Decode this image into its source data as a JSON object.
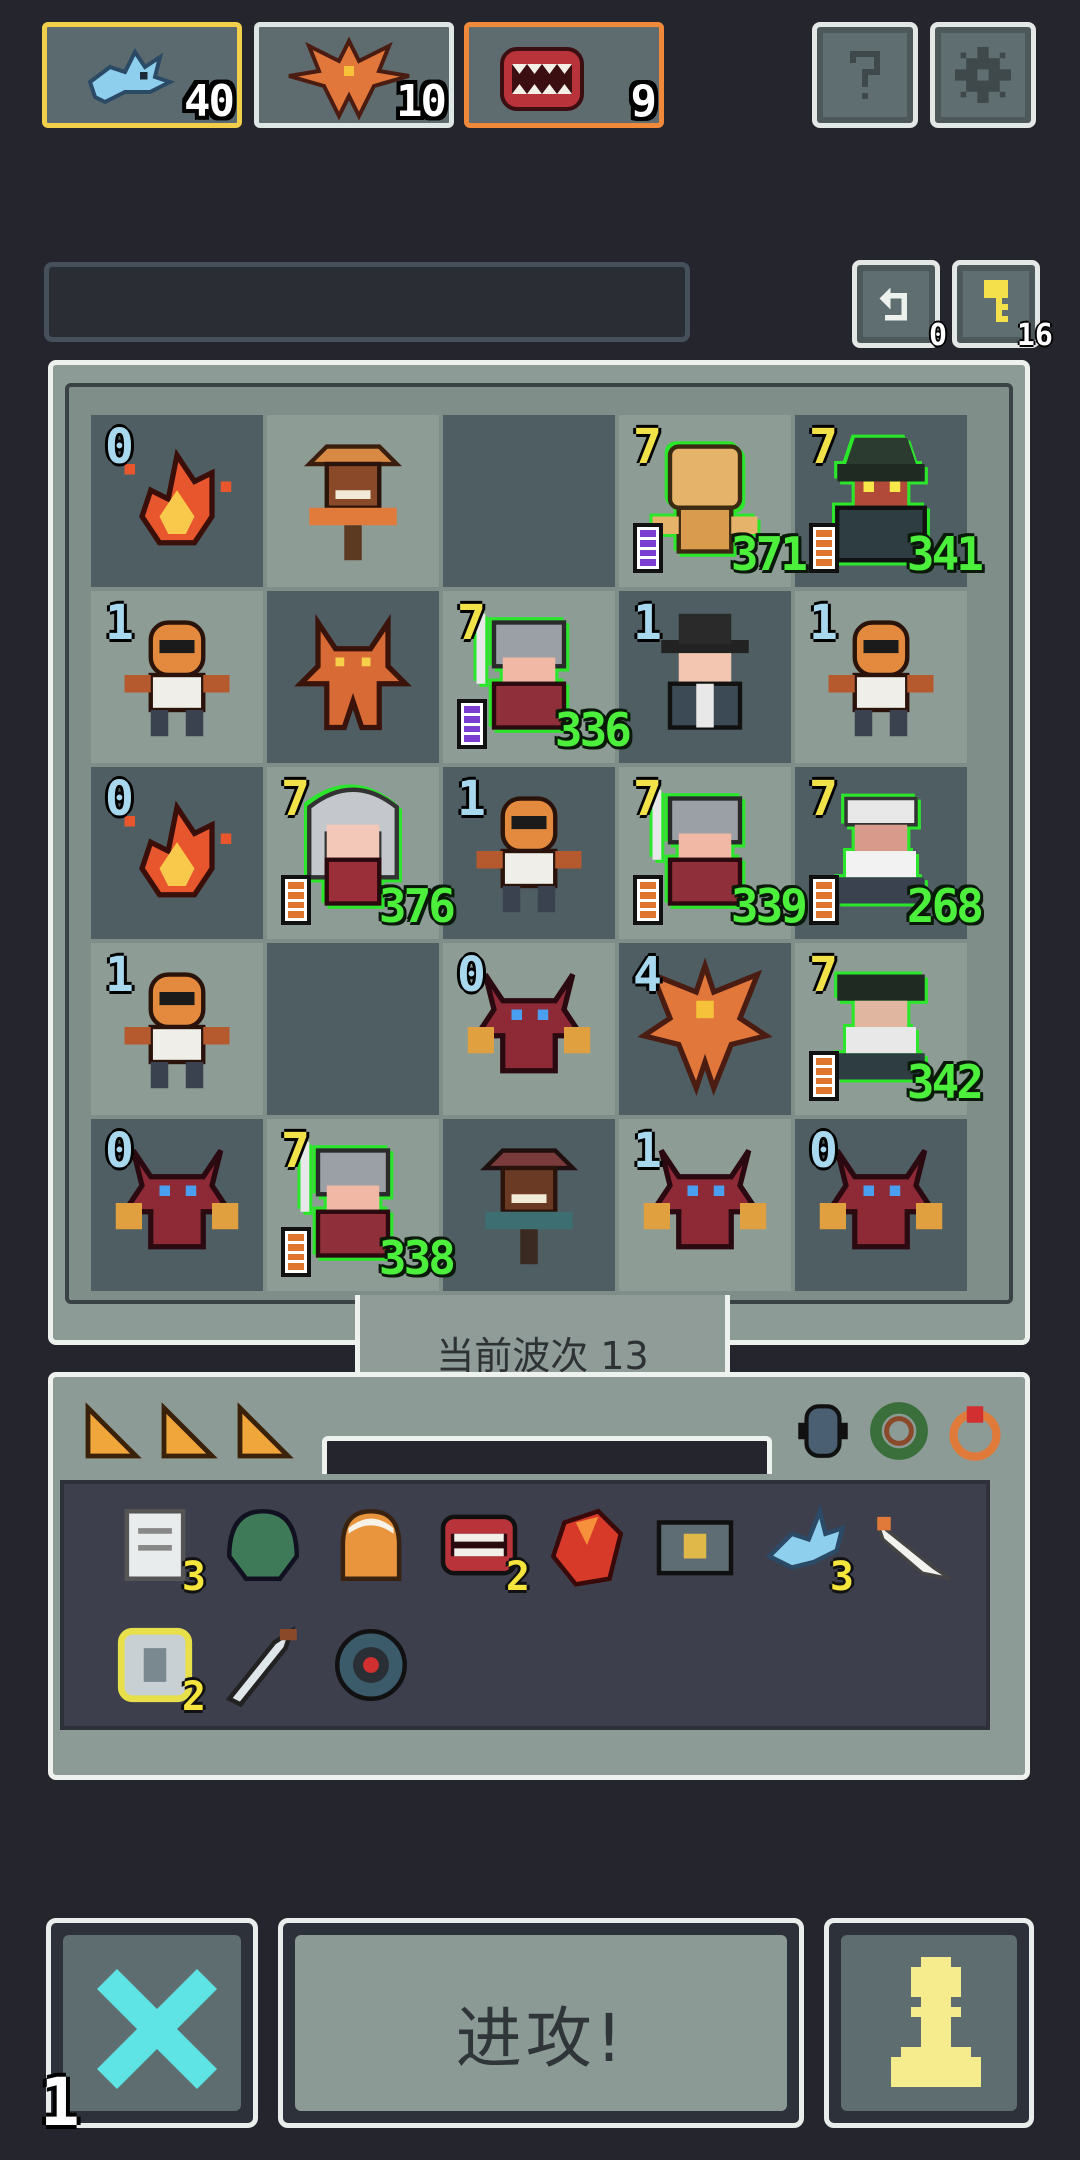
{
  "resources": [
    {
      "name": "blue-dragon-unit",
      "count": "40",
      "border": "#f2cf4a"
    },
    {
      "name": "phoenix-unit",
      "count": "10",
      "border": "#dfe6e6"
    },
    {
      "name": "mimic-unit",
      "count": "9",
      "border": "#f08a3a"
    }
  ],
  "top_buttons": {
    "help_icon": "question-icon",
    "settings_icon": "gear-icon"
  },
  "counters": {
    "undo": "0",
    "keys": "16"
  },
  "board": {
    "rows": [
      [
        {
          "kind": "fire",
          "lvl": "0",
          "lvlColor": "blue"
        },
        {
          "kind": "scarecrow",
          "lvl": ""
        },
        {
          "kind": "empty",
          "lvl": ""
        },
        {
          "kind": "straw-dummy",
          "lvl": "7",
          "lvlColor": "yellow",
          "hp": "371",
          "battery": "purple"
        },
        {
          "kind": "pirate-captain",
          "lvl": "7",
          "lvlColor": "yellow",
          "hp": "341",
          "battery": "orange"
        }
      ],
      [
        {
          "kind": "bandit",
          "lvl": "1",
          "lvlColor": "blue"
        },
        {
          "kind": "gargoyle",
          "lvl": ""
        },
        {
          "kind": "knight",
          "lvl": "7",
          "lvlColor": "yellow",
          "hp": "336",
          "battery": "purple"
        },
        {
          "kind": "magician",
          "lvl": "1",
          "lvlColor": "blue"
        },
        {
          "kind": "bandit",
          "lvl": "1",
          "lvlColor": "blue"
        }
      ],
      [
        {
          "kind": "fire",
          "lvl": "0",
          "lvlColor": "blue"
        },
        {
          "kind": "silver-maiden",
          "lvl": "7",
          "lvlColor": "yellow",
          "hp": "376",
          "battery": "orange"
        },
        {
          "kind": "bandit",
          "lvl": "1",
          "lvlColor": "blue"
        },
        {
          "kind": "knight",
          "lvl": "7",
          "lvlColor": "yellow",
          "hp": "339",
          "battery": "orange"
        },
        {
          "kind": "old-sage",
          "lvl": "7",
          "lvlColor": "yellow",
          "hp": "268",
          "battery": "orange"
        }
      ],
      [
        {
          "kind": "bandit",
          "lvl": "1",
          "lvlColor": "blue"
        },
        {
          "kind": "empty",
          "lvl": ""
        },
        {
          "kind": "imp",
          "lvl": "0",
          "lvlColor": "blue"
        },
        {
          "kind": "phoenix",
          "lvl": "4",
          "lvlColor": "blue"
        },
        {
          "kind": "old-pirate",
          "lvl": "7",
          "lvlColor": "yellow",
          "hp": "342",
          "battery": "orange"
        }
      ],
      [
        {
          "kind": "imp",
          "lvl": "0",
          "lvlColor": "blue"
        },
        {
          "kind": "knight",
          "lvl": "7",
          "lvlColor": "yellow",
          "hp": "338",
          "battery": "orange"
        },
        {
          "kind": "dark-scarecrow",
          "lvl": ""
        },
        {
          "kind": "imp",
          "lvl": "1",
          "lvlColor": "blue"
        },
        {
          "kind": "imp",
          "lvl": "0",
          "lvlColor": "blue"
        }
      ]
    ]
  },
  "wave": {
    "label": "当前波次 13"
  },
  "inventory": {
    "upgrades": [
      "cheese-wedge-icon",
      "cheese-wedge-icon",
      "cheese-wedge-icon"
    ],
    "relics": [
      "beetle-icon",
      "wreath-icon",
      "red-ring-icon"
    ],
    "items": [
      {
        "icon": "scroll-icon",
        "qty": "3"
      },
      {
        "icon": "green-helmet-icon",
        "qty": ""
      },
      {
        "icon": "bread-icon",
        "qty": ""
      },
      {
        "icon": "mimic-jaw-icon",
        "qty": "2"
      },
      {
        "icon": "ruby-icon",
        "qty": ""
      },
      {
        "icon": "chest-icon",
        "qty": ""
      },
      {
        "icon": "blue-dragon-icon",
        "qty": "3"
      },
      {
        "icon": "feather-quill-icon",
        "qty": ""
      },
      {
        "icon": "armor-plate-icon",
        "qty": "2"
      },
      {
        "icon": "blade-icon",
        "qty": ""
      },
      {
        "icon": "target-disc-icon",
        "qty": ""
      }
    ]
  },
  "bottom": {
    "attack_label": "进攻!",
    "remove_count": "1"
  }
}
